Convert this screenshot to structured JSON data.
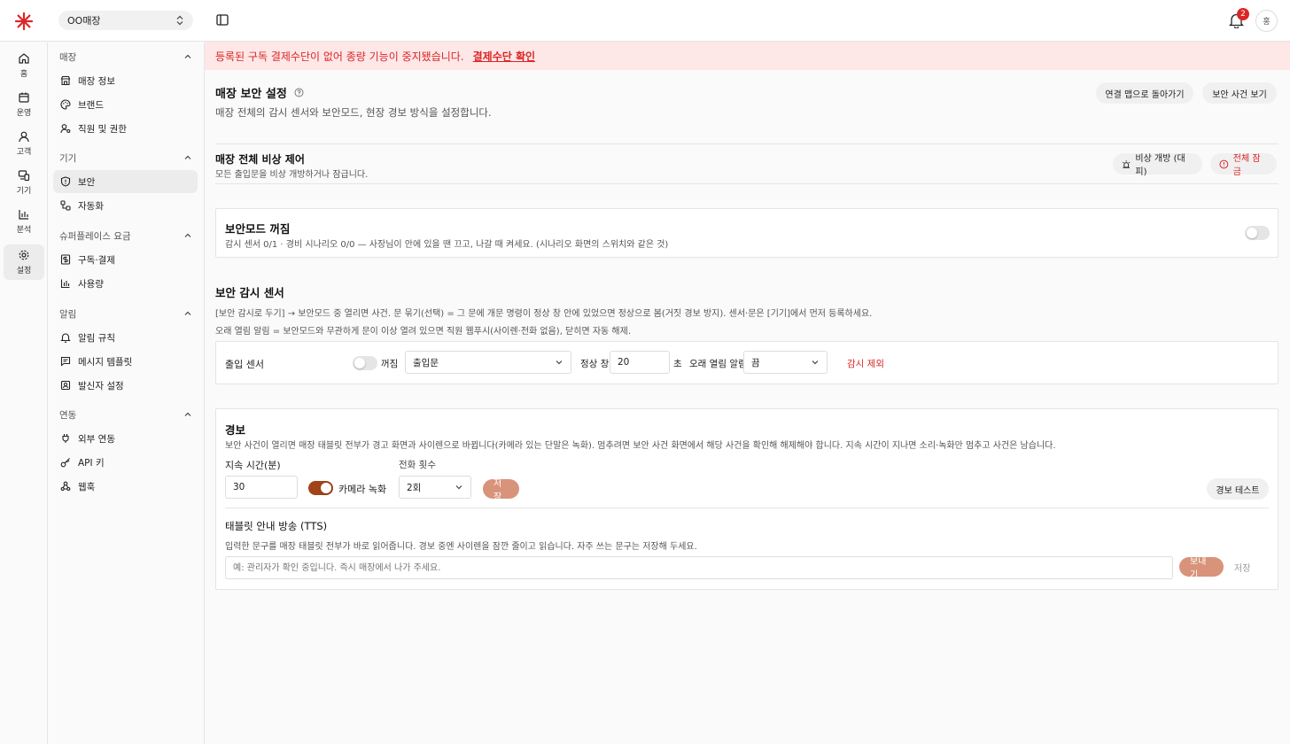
{
  "header": {
    "store_name": "OO매장",
    "notification_count": "2",
    "avatar_initial": "홍"
  },
  "rail": [
    {
      "label": "홈",
      "icon": "home-icon"
    },
    {
      "label": "운영",
      "icon": "calendar-icon"
    },
    {
      "label": "고객",
      "icon": "user-icon"
    },
    {
      "label": "기기",
      "icon": "devices-icon"
    },
    {
      "label": "분석",
      "icon": "bar-chart-icon"
    },
    {
      "label": "설정",
      "icon": "gear-icon"
    }
  ],
  "sidebar": {
    "groups": [
      {
        "title": "매장",
        "items": [
          "매장 정보",
          "브랜드",
          "직원 및 권한"
        ]
      },
      {
        "title": "기기",
        "items": [
          "보안",
          "자동화"
        ]
      },
      {
        "title": "슈퍼플레이스 요금",
        "items": [
          "구독·결제",
          "사용량"
        ]
      },
      {
        "title": "알림",
        "items": [
          "알림 규칙",
          "메시지 템플릿",
          "발신자 설정"
        ]
      },
      {
        "title": "연동",
        "items": [
          "외부 연동",
          "API 키",
          "웹훅"
        ]
      }
    ]
  },
  "banner": {
    "message": "등록된 구독 결제수단이 없어 종량 기능이 중지됐습니다.",
    "link": "결제수단 확인"
  },
  "page": {
    "title": "매장 보안 설정",
    "subtitle": "매장 전체의 감시 센서와 보안모드, 현장 경보 방식을 설정합니다.",
    "back_button": "연결 맵으로 돌아가기",
    "events_button": "보안 사건 보기"
  },
  "emergency": {
    "title": "매장 전체 비상 제어",
    "desc": "모든 출입문을 비상 개방하거나 잠급니다.",
    "open_button": "비상 개방 (대피)",
    "lock_button": "전체 잠금"
  },
  "security_mode": {
    "title": "보안모드 꺼짐",
    "desc": "감시 센서 0/1 · 경비 시나리오 0/0 — 사장님이 안에 있을 땐 끄고, 나갈 때 켜세요. (시나리오 화면의 스위치와 같은 것)"
  },
  "sensors": {
    "title": "보안 감시 센서",
    "desc1": "[보안 감시로 두기] → 보안모드 중 열리면 사건. 문 묶기(선택) = 그 문에 개문 명령이 정상 창 안에 있었으면 정상으로 봄(거짓 경보 방지). 센서·문은 [기기]에서 먼저 등록하세요.",
    "desc2": "오래 열림 알림 = 보안모드와 무관하게 문이 이상 열려 있으면 직원 웹푸시(사이렌·전화 없음), 닫히면 자동 해제.",
    "row": {
      "name": "출입 센서",
      "toggle_label": "꺼짐",
      "door_select": "출입문",
      "window_label": "정상 창",
      "window_value": "20",
      "unit": "초",
      "long_open_label": "오래 열림 알림",
      "long_open_value": "끔",
      "exclude_link": "감시 제외"
    }
  },
  "alarm": {
    "title": "경보",
    "desc": "보안 사건이 열리면 매장 태블릿 전부가 경고 화면과 사이렌으로 바뀝니다(카메라 있는 단말은 녹화). 멈추려면 보안 사건 화면에서 해당 사건을 확인해 해제해야 합니다. 지속 시간이 지나면 소리·녹화만 멈추고 사건은 남습니다.",
    "duration_label": "지속 시간(분)",
    "duration_value": "30",
    "camera_label": "카메라 녹화",
    "calls_label": "전화 횟수",
    "calls_value": "2회",
    "save_button": "저장",
    "test_button": "경보 테스트"
  },
  "tts": {
    "title": "태블릿 안내 방송 (TTS)",
    "desc": "입력한 문구를 매장 태블릿 전부가 바로 읽어줍니다. 경보 중엔 사이렌을 잠깐 줄이고 읽습니다. 자주 쓰는 문구는 저장해 두세요.",
    "placeholder": "예: 관리자가 확인 중입니다. 즉시 매장에서 나가 주세요.",
    "send_button": "보내기",
    "save_button": "저장"
  },
  "colors": {
    "accent": "#a0441a",
    "danger": "#dc2626",
    "banner_bg": "#fde7e7"
  }
}
